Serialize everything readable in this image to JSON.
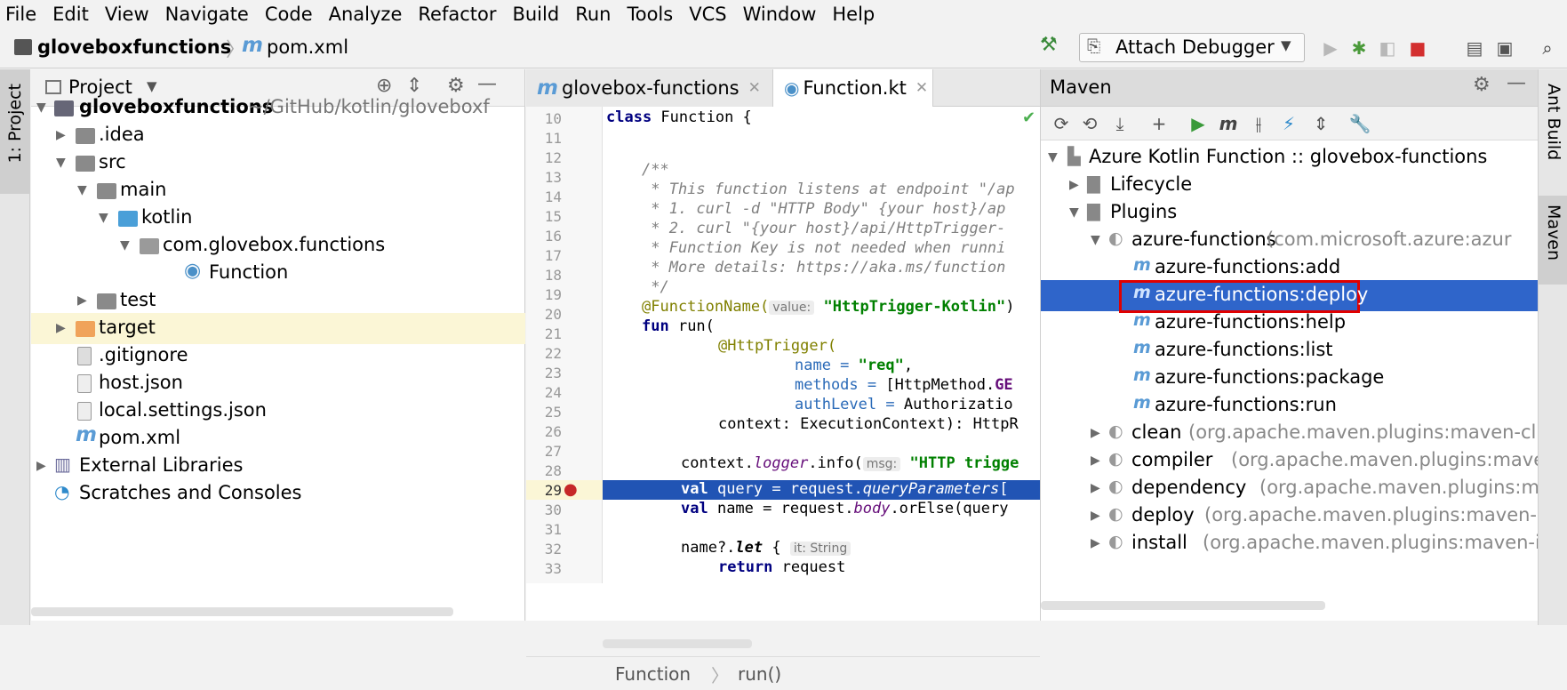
{
  "menu": [
    "File",
    "Edit",
    "View",
    "Navigate",
    "Code",
    "Analyze",
    "Refactor",
    "Build",
    "Run",
    "Tools",
    "VCS",
    "Window",
    "Help"
  ],
  "nav": {
    "project": "gloveboxfunctions",
    "file": "pom.xml",
    "config": "Attach Debugger"
  },
  "left_strip": {
    "project_tab": "1: Project"
  },
  "right_strip": {
    "ant_tab": "Ant Build",
    "maven_tab": "Maven"
  },
  "project_panel": {
    "title": "Project",
    "tree": [
      {
        "label": "gloveboxfunctions",
        "sub": "~/GitHub/kotlin/gloveboxf"
      },
      {
        "label": ".idea"
      },
      {
        "label": "src"
      },
      {
        "label": "main"
      },
      {
        "label": "kotlin"
      },
      {
        "label": "com.glovebox.functions"
      },
      {
        "label": "Function"
      },
      {
        "label": "test"
      },
      {
        "label": "target"
      },
      {
        "label": ".gitignore"
      },
      {
        "label": "host.json"
      },
      {
        "label": "local.settings.json"
      },
      {
        "label": "pom.xml"
      },
      {
        "label": "External Libraries"
      },
      {
        "label": "Scratches and Consoles"
      }
    ]
  },
  "editor": {
    "tabs": [
      "glovebox-functions",
      "Function.kt"
    ],
    "line_numbers": [
      "10",
      "11",
      "12",
      "13",
      "14",
      "15",
      "16",
      "17",
      "18",
      "19",
      "20",
      "21",
      "22",
      "23",
      "24",
      "25",
      "26",
      "27",
      "28",
      "29",
      "30",
      "31",
      "32",
      "33"
    ],
    "code": {
      "l10a": "class",
      "l10b": " Function {",
      "l12": "/**",
      "l13": " * This function listens at endpoint \"/ap",
      "l14": " * 1. curl -d \"HTTP Body\" {your host}/ap",
      "l15": " * 2. curl \"{your host}/api/HttpTrigger-",
      "l16": " * Function Key is not needed when runni",
      "l17": " * More details: https://aka.ms/function",
      "l18": " */",
      "l19a": "@FunctionName(",
      "l19h": "value:",
      "l19s": "\"HttpTrigger-Kotlin\"",
      "l19b": ")",
      "l20a": "fun",
      "l20b": " run(",
      "l21": "@HttpTrigger(",
      "l22a": "name = ",
      "l22s": "\"req\"",
      "l22b": ",",
      "l23a": "methods = ",
      "l23b": "[HttpMethod.",
      "l23c": "GE",
      "l24a": "authLevel = ",
      "l24b": "Authorizatio",
      "l25": "context: ExecutionContext): HttpR",
      "l27a": "context.",
      "l27b": "logger",
      "l27c": ".info(",
      "l27h": "msg:",
      "l27s": "\"HTTP trigge",
      "l29a": "val",
      "l29b": " query = request.",
      "l29c": "queryParameters",
      "l29d": "[",
      "l30a": "val",
      "l30b": " name = request.",
      "l30c": "body",
      "l30d": ".orElse(query",
      "l32a": "name?.",
      "l32b": "let",
      "l32c": " {",
      "l32h": "it: String",
      "l33a": "return",
      "l33b": " request"
    },
    "breadcrumb": [
      "Function",
      "run()"
    ]
  },
  "maven": {
    "title": "Maven",
    "rows": [
      {
        "label": "Azure Kotlin Function :: glovebox-functions",
        "sub": ""
      },
      {
        "label": "Lifecycle",
        "sub": ""
      },
      {
        "label": "Plugins",
        "sub": ""
      },
      {
        "label": "azure-functions",
        "sub": "(com.microsoft.azure:azur"
      },
      {
        "label": "azure-functions:add",
        "sub": ""
      },
      {
        "label": "azure-functions:deploy",
        "sub": ""
      },
      {
        "label": "azure-functions:help",
        "sub": ""
      },
      {
        "label": "azure-functions:list",
        "sub": ""
      },
      {
        "label": "azure-functions:package",
        "sub": ""
      },
      {
        "label": "azure-functions:run",
        "sub": ""
      },
      {
        "label": "clean",
        "sub": "(org.apache.maven.plugins:maven-cl"
      },
      {
        "label": "compiler",
        "sub": "(org.apache.maven.plugins:mave"
      },
      {
        "label": "dependency",
        "sub": "(org.apache.maven.plugins:m"
      },
      {
        "label": "deploy",
        "sub": "(org.apache.maven.plugins:maven-"
      },
      {
        "label": "install",
        "sub": "(org.apache.maven.plugins:maven-i"
      }
    ]
  },
  "colors": {
    "selection": "#2f65ca",
    "highlight_box": "#e00000",
    "current_line": "#fbf6d6",
    "exec_line": "#2154b4"
  }
}
